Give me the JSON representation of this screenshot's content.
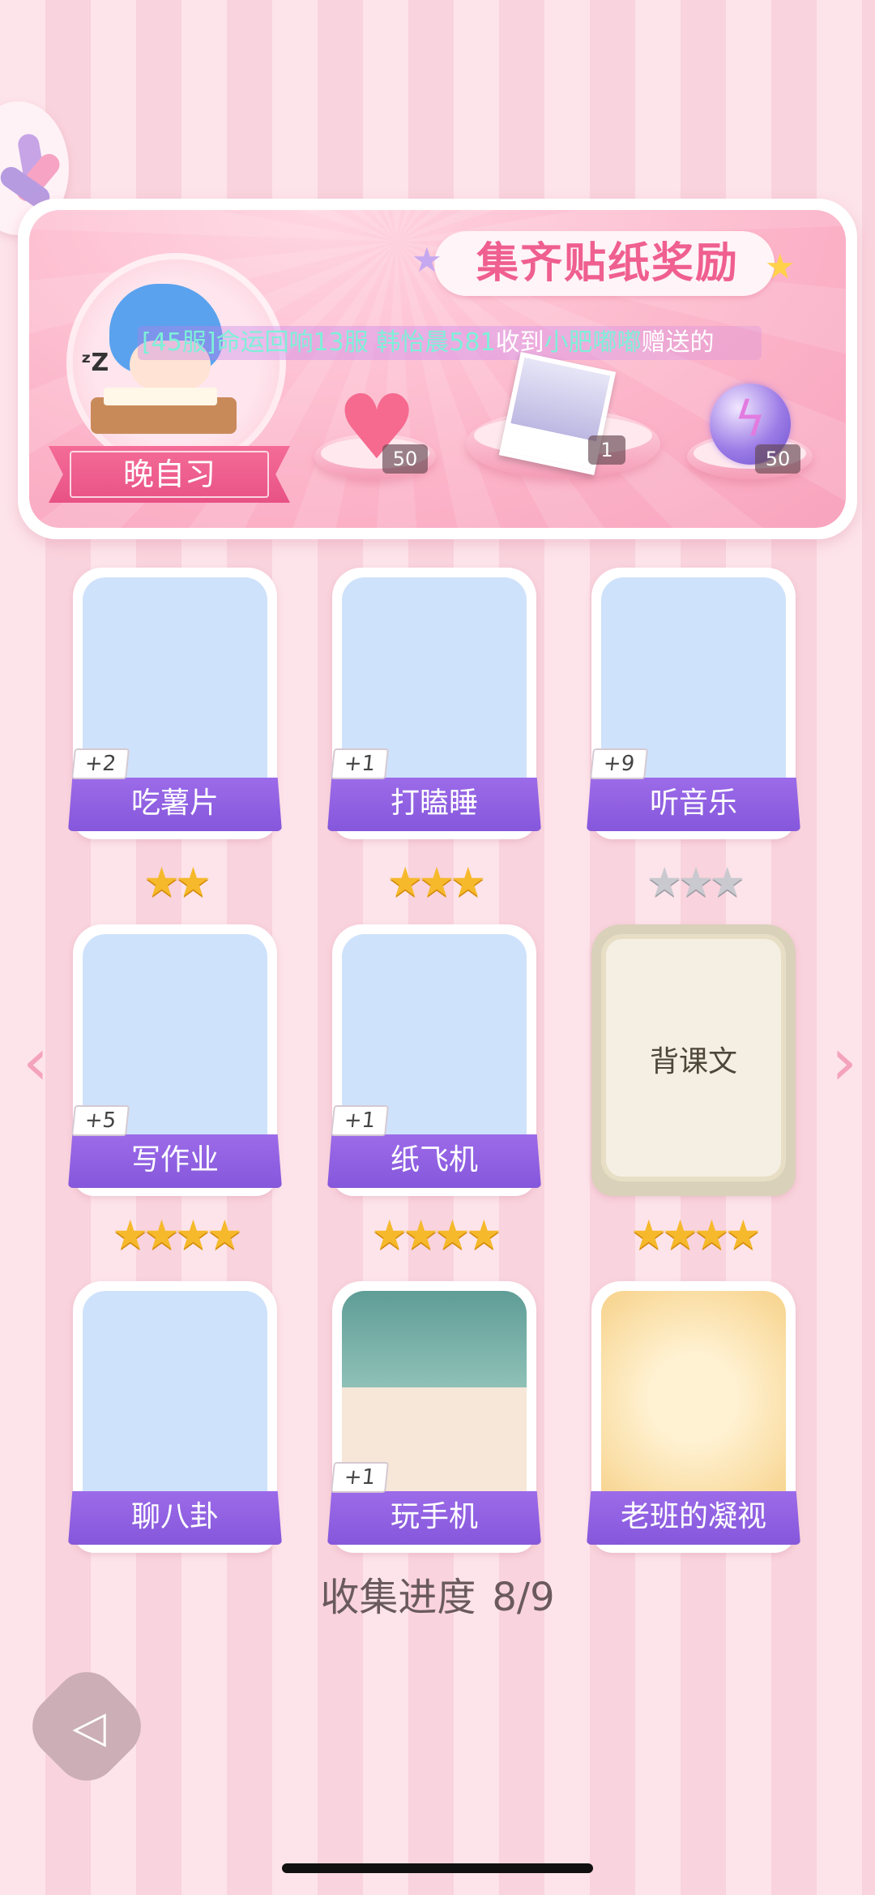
{
  "banner": {
    "title": "集齐贴纸奖励",
    "marquee_prefix": "[45服]命运回响13服 韩怡晨581",
    "marquee_mid": "收到",
    "marquee_sender": "小肥嘟嘟",
    "marquee_suffix": "赠送的",
    "featured_label": "晚自习",
    "rewards": [
      {
        "icon": "heart-gem-icon",
        "count": "50"
      },
      {
        "icon": "photo-card-icon",
        "count": "1"
      },
      {
        "icon": "lightning-orb-icon",
        "count": "50"
      }
    ]
  },
  "stickers": [
    {
      "label": "吃薯片",
      "badge": "+2",
      "stars": "",
      "locked": false
    },
    {
      "label": "打瞌睡",
      "badge": "+1",
      "stars": "",
      "locked": false
    },
    {
      "label": "听音乐",
      "badge": "+9",
      "stars": "",
      "locked": false
    },
    {
      "label": "写作业",
      "badge": "+5",
      "stars": "★★",
      "locked": false
    },
    {
      "label": "纸飞机",
      "badge": "+1",
      "stars": "★★★",
      "locked": false
    },
    {
      "label": "背课文",
      "badge": "",
      "stars": "★★★",
      "locked": true
    },
    {
      "label": "聊八卦",
      "badge": "",
      "stars": "★★★★",
      "locked": false
    },
    {
      "label": "玩手机",
      "badge": "+1",
      "stars": "★★★★",
      "locked": false
    },
    {
      "label": "老班的凝视",
      "badge": "",
      "stars": "★★★★",
      "locked": false
    }
  ],
  "nav": {
    "prev": "‹",
    "next": "›"
  },
  "progress": {
    "label": "收集进度",
    "value": "8/9"
  },
  "colors": {
    "accent": "#8557db",
    "pink": "#ef5f90",
    "star": "#f6b92c"
  }
}
